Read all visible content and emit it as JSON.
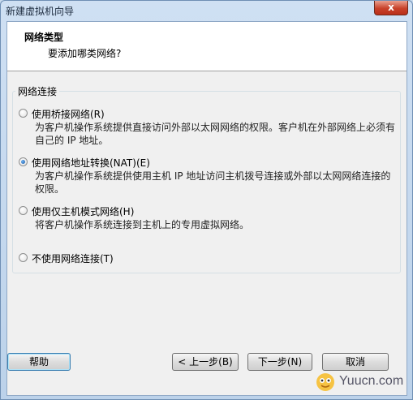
{
  "window": {
    "title": "新建虚拟机向导",
    "close_glyph": "x"
  },
  "header": {
    "title": "网络类型",
    "subtitle": "要添加哪类网络?"
  },
  "group": {
    "legend": "网络连接"
  },
  "options": [
    {
      "label": "使用桥接网络(R)",
      "checked": false,
      "desc": "为客户机操作系统提供直接访问外部以太网网络的权限。客户机在外部网络上必须有自己的 IP 地址。"
    },
    {
      "label": "使用网络地址转换(NAT)(E)",
      "checked": true,
      "desc": "为客户机操作系统提供使用主机 IP 地址访问主机拨号连接或外部以太网网络连接的权限。"
    },
    {
      "label": "使用仅主机模式网络(H)",
      "checked": false,
      "desc": "将客户机操作系统连接到主机上的专用虚拟网络。"
    },
    {
      "label": "不使用网络连接(T)",
      "checked": false,
      "desc": ""
    }
  ],
  "buttons": {
    "help": "帮助",
    "back": "< 上一步(B)",
    "next": "下一步(N)",
    "cancel": "取消"
  },
  "watermark": {
    "text": "Yuucn.com"
  }
}
